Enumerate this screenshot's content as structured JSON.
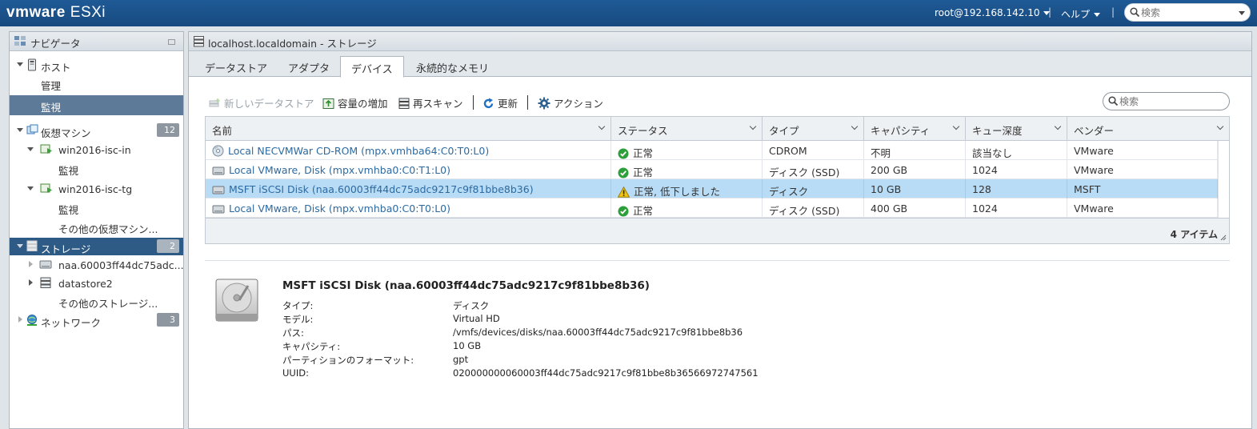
{
  "header": {
    "logo_vm": "vmware",
    "logo_product": "ESXi",
    "user": "root@192.168.142.10",
    "help": "ヘルプ",
    "separator": "|",
    "search_placeholder": "検索"
  },
  "navigator": {
    "title": "ナビゲータ",
    "host": "ホスト",
    "manage": "管理",
    "monitor": "監視",
    "vms": "仮想マシン",
    "vms_count": "12",
    "vm1": "win2016-isc-in",
    "vm1_monitor": "監視",
    "vm2": "win2016-isc-tg",
    "vm2_monitor": "監視",
    "more_vms": "その他の仮想マシン...",
    "storage": "ストレージ",
    "storage_count": "2",
    "storage_item1": "naa.60003ff44dc75adc...",
    "storage_item2": "datastore2",
    "more_storage": "その他のストレージ...",
    "network": "ネットワーク",
    "network_count": "3"
  },
  "main": {
    "title": "localhost.localdomain - ストレージ",
    "tabs": [
      "データストア",
      "アダプタ",
      "デバイス",
      "永続的なメモリ"
    ],
    "active_tab": "デバイス",
    "toolbar": {
      "new_datastore": "新しいデータストア",
      "increase_capacity": "容量の増加",
      "rescan": "再スキャン",
      "refresh": "更新",
      "actions": "アクション",
      "search_placeholder": "検索"
    },
    "columns": [
      "名前",
      "ステータス",
      "タイプ",
      "キャパシティ",
      "キュー深度",
      "ベンダー"
    ],
    "rows": [
      {
        "name": "Local NECVMWar CD-ROM (mpx.vmhba64:C0:T0:L0)",
        "status": "正常",
        "status_kind": "ok",
        "type": "CDROM",
        "capacity": "不明",
        "queue": "該当なし",
        "vendor": "VMware",
        "icon": "cdrom-icon"
      },
      {
        "name": "Local VMware, Disk (mpx.vmhba0:C0:T1:L0)",
        "status": "正常",
        "status_kind": "ok",
        "type": "ディスク (SSD)",
        "capacity": "200 GB",
        "queue": "1024",
        "vendor": "VMware",
        "icon": "disk-icon"
      },
      {
        "name": "MSFT iSCSI Disk (naa.60003ff44dc75adc9217c9f81bbe8b36)",
        "status": "正常, 低下しました",
        "status_kind": "warn",
        "type": "ディスク",
        "capacity": "10 GB",
        "queue": "128",
        "vendor": "MSFT",
        "icon": "disk-icon"
      },
      {
        "name": "Local VMware, Disk (mpx.vmhba0:C0:T0:L0)",
        "status": "正常",
        "status_kind": "ok",
        "type": "ディスク (SSD)",
        "capacity": "400 GB",
        "queue": "1024",
        "vendor": "VMware",
        "icon": "disk-icon"
      }
    ],
    "selected_row": 2,
    "item_count": "4 アイテム",
    "details": {
      "title": "MSFT iSCSI Disk (naa.60003ff44dc75adc9217c9f81bbe8b36)",
      "fields": [
        {
          "key": "タイプ:",
          "value": "ディスク"
        },
        {
          "key": "モデル:",
          "value": "Virtual HD"
        },
        {
          "key": "パス:",
          "value": "/vmfs/devices/disks/naa.60003ff44dc75adc9217c9f81bbe8b36"
        },
        {
          "key": "キャパシティ:",
          "value": "10 GB"
        },
        {
          "key": "パーティションのフォーマット:",
          "value": "gpt"
        },
        {
          "key": "UUID:",
          "value": "020000000060003ff44dc75adc9217c9f81bbe8b36566972747561"
        }
      ]
    }
  },
  "colors": {
    "header_bg": "#1f5a96",
    "selected_nav": "#2e5a86",
    "selected_row": "#b8dcf5",
    "link": "#2d6aa1",
    "ok_green": "#2e9e3a",
    "warn_yellow": "#f1c40f"
  }
}
